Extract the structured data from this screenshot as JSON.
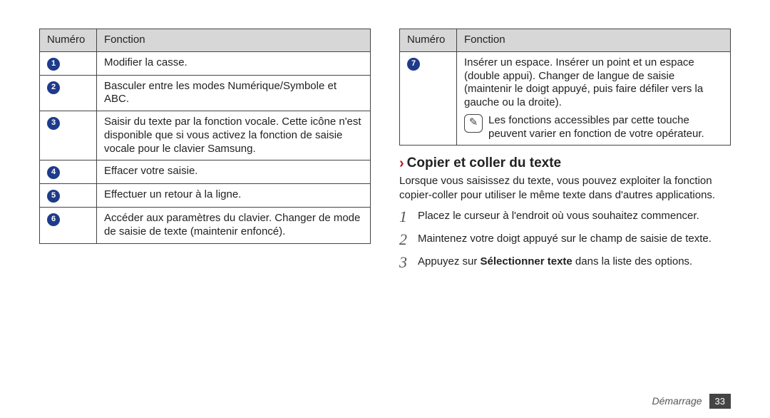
{
  "left_table": {
    "headers": {
      "num": "Numéro",
      "func": "Fonction"
    },
    "rows": [
      {
        "n": "1",
        "text": "Modifier la casse."
      },
      {
        "n": "2",
        "text": "Basculer entre les modes Numérique/Symbole et ABC."
      },
      {
        "n": "3",
        "text": "Saisir du texte par la fonction vocale. Cette icône n'est disponible que si vous activez la fonction de saisie vocale pour le clavier Samsung."
      },
      {
        "n": "4",
        "text": "Effacer votre saisie."
      },
      {
        "n": "5",
        "text": "Effectuer un retour à la ligne."
      },
      {
        "n": "6",
        "text": "Accéder aux paramètres du clavier. Changer de mode de saisie de texte (maintenir enfoncé)."
      }
    ]
  },
  "right_table": {
    "headers": {
      "num": "Numéro",
      "func": "Fonction"
    },
    "row7": {
      "n": "7",
      "text": "Insérer un espace. Insérer un point et un espace (double appui). Changer de langue de saisie (maintenir le doigt appuyé, puis faire défiler vers la gauche ou la droite).",
      "note": "Les fonctions accessibles par cette touche peuvent varier en fonction de votre opérateur."
    }
  },
  "section": {
    "heading": "Copier et coller du texte",
    "intro": "Lorsque vous saisissez du texte, vous pouvez exploiter la fonction copier-coller pour utiliser le même texte dans d'autres applications.",
    "steps": [
      "Placez le curseur à l'endroit où vous souhaitez commencer.",
      "Maintenez votre doigt appuyé sur le champ de saisie de texte.",
      "Appuyez sur <strong>Sélectionner texte</strong> dans la liste des options."
    ]
  },
  "footer": {
    "chapter": "Démarrage",
    "page": "33"
  },
  "icons": {
    "note_glyph": "✎"
  }
}
